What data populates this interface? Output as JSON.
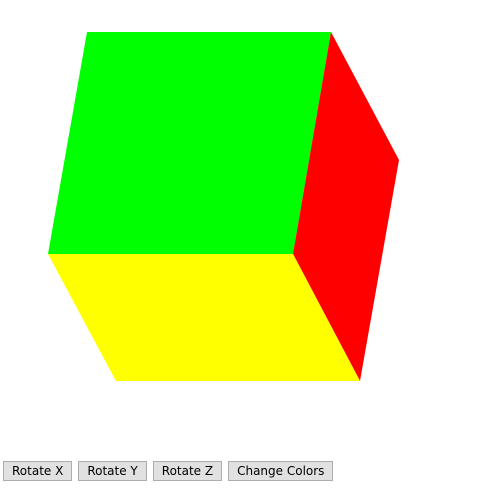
{
  "cube": {
    "faces": [
      {
        "name": "front",
        "color": "#00ff00"
      },
      {
        "name": "side",
        "color": "#ff0000"
      },
      {
        "name": "bottom",
        "color": "#ffff00"
      }
    ]
  },
  "controls": {
    "rotate_x": "Rotate X",
    "rotate_y": "Rotate Y",
    "rotate_z": "Rotate Z",
    "change_colors": "Change Colors"
  }
}
